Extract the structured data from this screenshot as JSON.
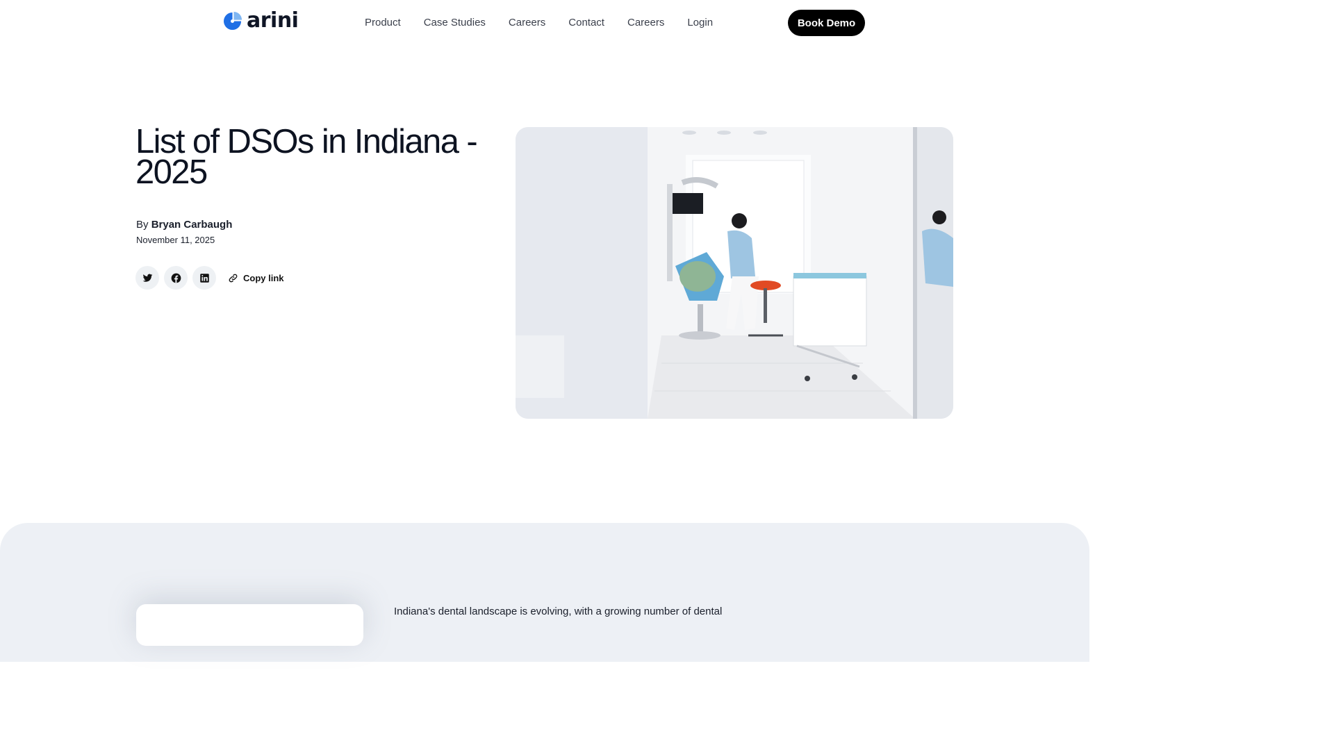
{
  "brand": {
    "name": "arini",
    "primary_color": "#1f6fe5",
    "accent_color": "#7fb6f2"
  },
  "nav": {
    "items": [
      "Product",
      "Case Studies",
      "Careers",
      "Contact",
      "Careers",
      "Login"
    ],
    "cta": "Book Demo"
  },
  "article": {
    "title": "List of DSOs in Indiana - 2025",
    "byline_prefix": "By",
    "author": "Bryan Carbaugh",
    "date": "November 11, 2025",
    "share": {
      "icons": [
        "twitter-icon",
        "facebook-icon",
        "linkedin-icon",
        "link-icon"
      ],
      "copy_link_label": "Copy link"
    },
    "intro_text": "Indiana's dental landscape is evolving, with a growing number of dental"
  },
  "colors": {
    "band_background": "#edf0f5",
    "cta_background": "#000000",
    "text": "#0d1321"
  }
}
